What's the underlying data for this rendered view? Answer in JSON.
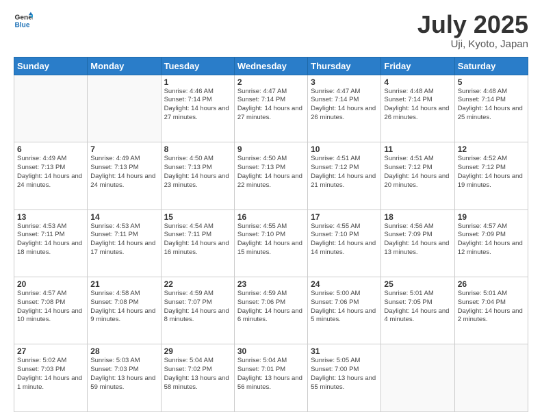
{
  "header": {
    "logo_line1": "General",
    "logo_line2": "Blue",
    "title": "July 2025",
    "subtitle": "Uji, Kyoto, Japan"
  },
  "weekdays": [
    "Sunday",
    "Monday",
    "Tuesday",
    "Wednesday",
    "Thursday",
    "Friday",
    "Saturday"
  ],
  "weeks": [
    [
      {
        "day": "",
        "info": ""
      },
      {
        "day": "",
        "info": ""
      },
      {
        "day": "1",
        "info": "Sunrise: 4:46 AM\nSunset: 7:14 PM\nDaylight: 14 hours and 27 minutes."
      },
      {
        "day": "2",
        "info": "Sunrise: 4:47 AM\nSunset: 7:14 PM\nDaylight: 14 hours and 27 minutes."
      },
      {
        "day": "3",
        "info": "Sunrise: 4:47 AM\nSunset: 7:14 PM\nDaylight: 14 hours and 26 minutes."
      },
      {
        "day": "4",
        "info": "Sunrise: 4:48 AM\nSunset: 7:14 PM\nDaylight: 14 hours and 26 minutes."
      },
      {
        "day": "5",
        "info": "Sunrise: 4:48 AM\nSunset: 7:14 PM\nDaylight: 14 hours and 25 minutes."
      }
    ],
    [
      {
        "day": "6",
        "info": "Sunrise: 4:49 AM\nSunset: 7:13 PM\nDaylight: 14 hours and 24 minutes."
      },
      {
        "day": "7",
        "info": "Sunrise: 4:49 AM\nSunset: 7:13 PM\nDaylight: 14 hours and 24 minutes."
      },
      {
        "day": "8",
        "info": "Sunrise: 4:50 AM\nSunset: 7:13 PM\nDaylight: 14 hours and 23 minutes."
      },
      {
        "day": "9",
        "info": "Sunrise: 4:50 AM\nSunset: 7:13 PM\nDaylight: 14 hours and 22 minutes."
      },
      {
        "day": "10",
        "info": "Sunrise: 4:51 AM\nSunset: 7:12 PM\nDaylight: 14 hours and 21 minutes."
      },
      {
        "day": "11",
        "info": "Sunrise: 4:51 AM\nSunset: 7:12 PM\nDaylight: 14 hours and 20 minutes."
      },
      {
        "day": "12",
        "info": "Sunrise: 4:52 AM\nSunset: 7:12 PM\nDaylight: 14 hours and 19 minutes."
      }
    ],
    [
      {
        "day": "13",
        "info": "Sunrise: 4:53 AM\nSunset: 7:11 PM\nDaylight: 14 hours and 18 minutes."
      },
      {
        "day": "14",
        "info": "Sunrise: 4:53 AM\nSunset: 7:11 PM\nDaylight: 14 hours and 17 minutes."
      },
      {
        "day": "15",
        "info": "Sunrise: 4:54 AM\nSunset: 7:11 PM\nDaylight: 14 hours and 16 minutes."
      },
      {
        "day": "16",
        "info": "Sunrise: 4:55 AM\nSunset: 7:10 PM\nDaylight: 14 hours and 15 minutes."
      },
      {
        "day": "17",
        "info": "Sunrise: 4:55 AM\nSunset: 7:10 PM\nDaylight: 14 hours and 14 minutes."
      },
      {
        "day": "18",
        "info": "Sunrise: 4:56 AM\nSunset: 7:09 PM\nDaylight: 14 hours and 13 minutes."
      },
      {
        "day": "19",
        "info": "Sunrise: 4:57 AM\nSunset: 7:09 PM\nDaylight: 14 hours and 12 minutes."
      }
    ],
    [
      {
        "day": "20",
        "info": "Sunrise: 4:57 AM\nSunset: 7:08 PM\nDaylight: 14 hours and 10 minutes."
      },
      {
        "day": "21",
        "info": "Sunrise: 4:58 AM\nSunset: 7:08 PM\nDaylight: 14 hours and 9 minutes."
      },
      {
        "day": "22",
        "info": "Sunrise: 4:59 AM\nSunset: 7:07 PM\nDaylight: 14 hours and 8 minutes."
      },
      {
        "day": "23",
        "info": "Sunrise: 4:59 AM\nSunset: 7:06 PM\nDaylight: 14 hours and 6 minutes."
      },
      {
        "day": "24",
        "info": "Sunrise: 5:00 AM\nSunset: 7:06 PM\nDaylight: 14 hours and 5 minutes."
      },
      {
        "day": "25",
        "info": "Sunrise: 5:01 AM\nSunset: 7:05 PM\nDaylight: 14 hours and 4 minutes."
      },
      {
        "day": "26",
        "info": "Sunrise: 5:01 AM\nSunset: 7:04 PM\nDaylight: 14 hours and 2 minutes."
      }
    ],
    [
      {
        "day": "27",
        "info": "Sunrise: 5:02 AM\nSunset: 7:03 PM\nDaylight: 14 hours and 1 minute."
      },
      {
        "day": "28",
        "info": "Sunrise: 5:03 AM\nSunset: 7:03 PM\nDaylight: 13 hours and 59 minutes."
      },
      {
        "day": "29",
        "info": "Sunrise: 5:04 AM\nSunset: 7:02 PM\nDaylight: 13 hours and 58 minutes."
      },
      {
        "day": "30",
        "info": "Sunrise: 5:04 AM\nSunset: 7:01 PM\nDaylight: 13 hours and 56 minutes."
      },
      {
        "day": "31",
        "info": "Sunrise: 5:05 AM\nSunset: 7:00 PM\nDaylight: 13 hours and 55 minutes."
      },
      {
        "day": "",
        "info": ""
      },
      {
        "day": "",
        "info": ""
      }
    ]
  ]
}
